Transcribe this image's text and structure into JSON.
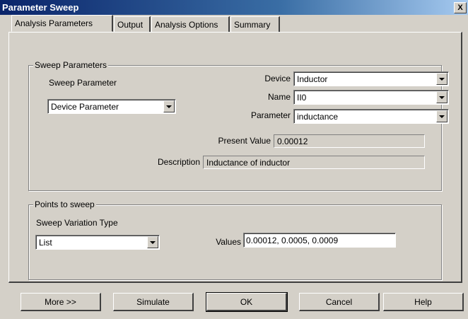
{
  "window": {
    "title": "Parameter Sweep",
    "close_glyph": "X"
  },
  "tabs": [
    {
      "label": "Analysis Parameters",
      "active": true
    },
    {
      "label": "Output",
      "active": false
    },
    {
      "label": "Analysis Options",
      "active": false
    },
    {
      "label": "Summary",
      "active": false
    }
  ],
  "sweep_parameters": {
    "group_label": "Sweep Parameters",
    "sweep_parameter_label": "Sweep Parameter",
    "sweep_parameter_value": "Device Parameter",
    "device_label": "Device",
    "device_value": "Inductor",
    "name_label": "Name",
    "name_value": "II0",
    "parameter_label": "Parameter",
    "parameter_value": "inductance",
    "present_value_label": "Present Value",
    "present_value": "0.00012",
    "description_label": "Description",
    "description_value": "Inductance of inductor"
  },
  "points_to_sweep": {
    "group_label": "Points to sweep",
    "variation_type_label": "Sweep Variation Type",
    "variation_type_value": "List",
    "values_label": "Values",
    "values_value": "0.00012, 0.0005, 0.0009"
  },
  "buttons": {
    "more": "More >>",
    "simulate": "Simulate",
    "ok": "OK",
    "cancel": "Cancel",
    "help": "Help"
  },
  "colors": {
    "dialog_bg": "#d4d0c8",
    "title_bar": "#0a246a",
    "field_bg": "#ffffff"
  }
}
